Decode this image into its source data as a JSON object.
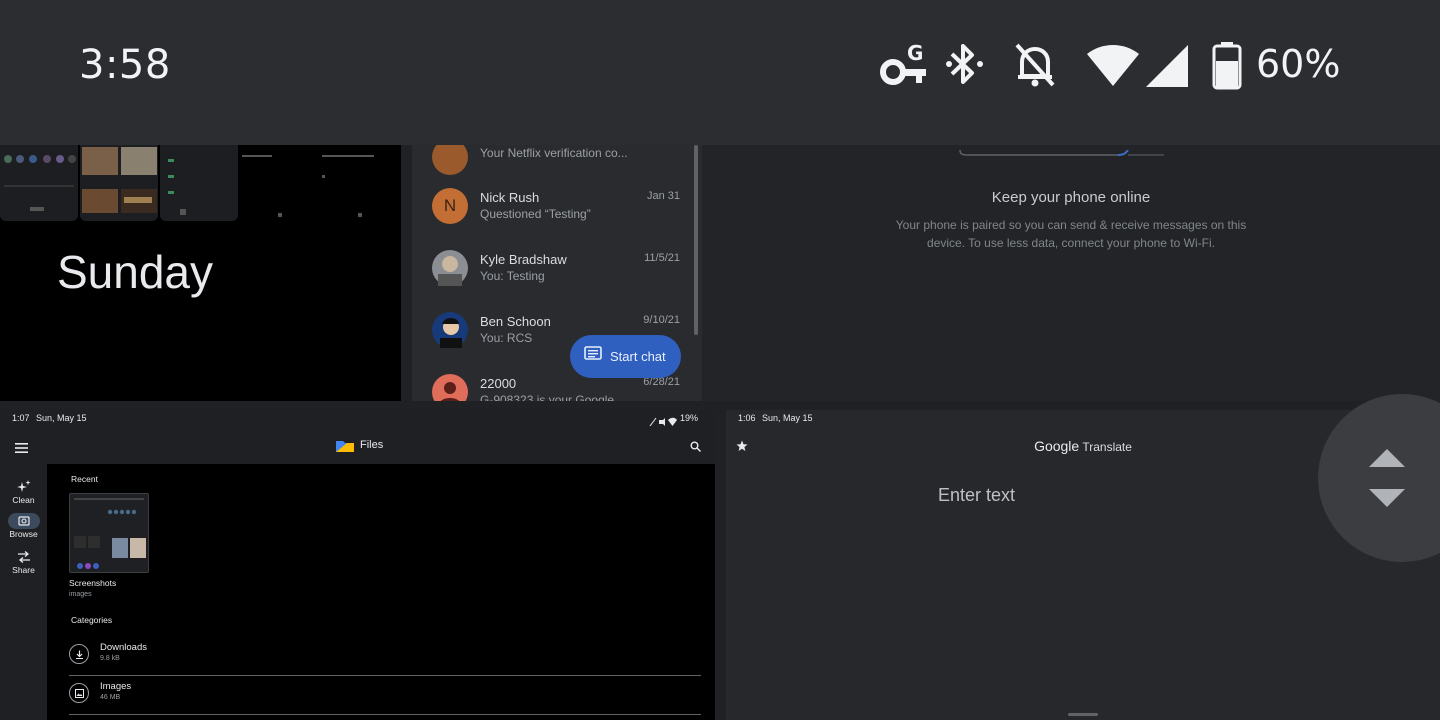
{
  "status_bar": {
    "time": "3:58",
    "icons": [
      "vpn-key-icon",
      "bluetooth-icon",
      "notifications-off-icon",
      "wifi-icon",
      "cellular-signal-icon",
      "battery-icon"
    ],
    "battery": "60%"
  },
  "sunday_tile": {
    "title": "Sunday"
  },
  "messages_tile": {
    "conversations": [
      {
        "name": "",
        "snippet": "Your Netflix verification co...",
        "date": "",
        "avatar_color": "#9a5a2c"
      },
      {
        "name": "Nick Rush",
        "snippet": "Questioned “Testing”",
        "date": "Jan 31",
        "initial": "N",
        "avatar_color": "#c26e34"
      },
      {
        "name": "Kyle Bradshaw",
        "snippet": "You: Testing",
        "date": "11/5/21",
        "avatar_color": "#8b8f94"
      },
      {
        "name": "Ben Schoon",
        "snippet": "You: RCS",
        "date": "9/10/21",
        "avatar_color": "#173a7a"
      },
      {
        "name": "22000",
        "snippet": "G-908323 is your Google",
        "date": "6/28/21",
        "avatar_color": "#e06c5a"
      }
    ],
    "fab_label": "Start chat"
  },
  "web_tile": {
    "title": "Keep your phone online",
    "description": "Your phone is paired so you can send & receive messages on this device. To use less data, connect your phone to Wi-Fi."
  },
  "files_tile": {
    "status_time": "1:07",
    "status_date": "Sun, May 15",
    "status_battery": "19%",
    "app_title": "Files",
    "rail": [
      {
        "label": "Clean",
        "icon": "sparkle-icon"
      },
      {
        "label": "Browse",
        "icon": "browse-icon"
      },
      {
        "label": "Share",
        "icon": "share-icon"
      }
    ],
    "recent_label": "Recent",
    "recent_item": {
      "name": "Screenshots",
      "type": "images"
    },
    "categories_label": "Categories",
    "categories": [
      {
        "name": "Downloads",
        "size": "9.8 kB",
        "icon": "download-icon"
      },
      {
        "name": "Images",
        "size": "46 MB",
        "icon": "image-icon"
      }
    ]
  },
  "translate_tile": {
    "status_time": "1:06",
    "status_date": "Sun, May 15",
    "title_brand": "Google",
    "title_app": " Translate",
    "placeholder": "Enter text"
  },
  "scroll_widget": {
    "icons": [
      "scroll-up-icon",
      "scroll-down-icon"
    ]
  },
  "colors": {
    "fab": "#2f5fbf",
    "status_bar": "#2b2d31",
    "background": "#202124"
  }
}
